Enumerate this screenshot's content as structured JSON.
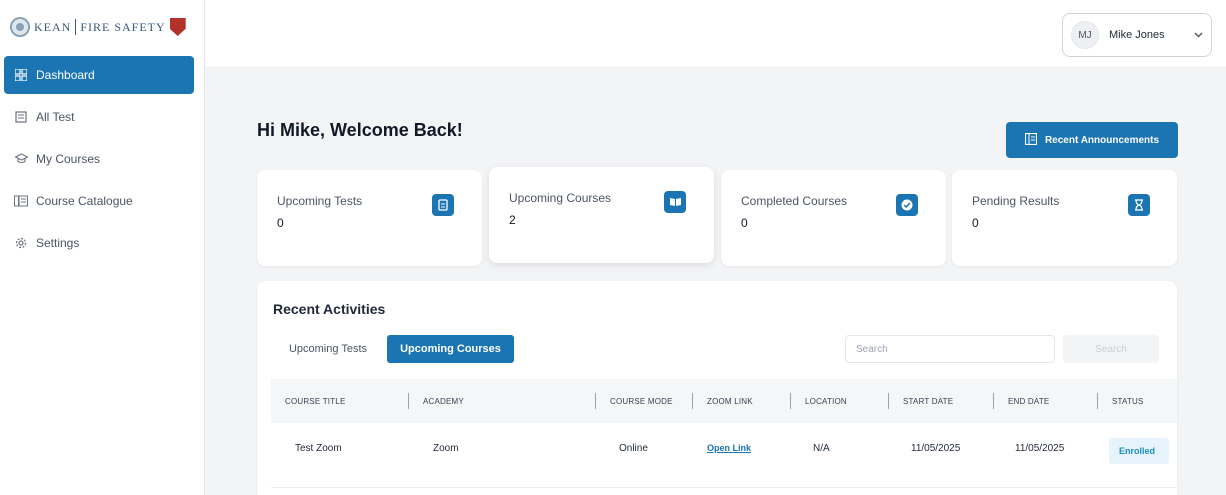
{
  "brand": {
    "left": "KEAN",
    "right": "FIRE SAFETY",
    "accent": "#1a75b2"
  },
  "sidebar": {
    "items": [
      {
        "label": "Dashboard",
        "icon": "grid-icon",
        "active": true
      },
      {
        "label": "All Test",
        "icon": "document-icon",
        "active": false
      },
      {
        "label": "My Courses",
        "icon": "graduation-cap-icon",
        "active": false
      },
      {
        "label": "Course Catalogue",
        "icon": "catalogue-icon",
        "active": false
      },
      {
        "label": "Settings",
        "icon": "gear-icon",
        "active": false
      }
    ]
  },
  "header": {
    "user": {
      "initials": "MJ",
      "name": "Mike Jones",
      "icon": "chevron-down-icon"
    }
  },
  "main": {
    "welcome": "Hi Mike, Welcome Back!",
    "announcements_label": "Recent Announcements",
    "stats": [
      {
        "label": "Upcoming Tests",
        "value": "0",
        "icon": "test-icon"
      },
      {
        "label": "Upcoming Courses",
        "value": "2",
        "icon": "book-icon"
      },
      {
        "label": "Completed Courses",
        "value": "0",
        "icon": "check-circle-icon"
      },
      {
        "label": "Pending Results",
        "value": "0",
        "icon": "hourglass-icon"
      }
    ]
  },
  "activity": {
    "title": "Recent Activities",
    "tabs": [
      {
        "label": "Upcoming Tests",
        "active": false
      },
      {
        "label": "Upcoming Courses",
        "active": true
      }
    ],
    "search": {
      "placeholder": "Search",
      "button_label": "Search"
    },
    "columns": [
      "COURSE TITLE",
      "ACADEMY",
      "COURSE MODE",
      "ZOOM LINK",
      "LOCATION",
      "START DATE",
      "END DATE",
      "STATUS"
    ],
    "rows": [
      {
        "course_title": "Test Zoom",
        "academy": "Zoom",
        "course_mode": "Online",
        "zoom_link": "Open Link",
        "location": "N/A",
        "start_date": "11/05/2025",
        "end_date": "11/05/2025",
        "status": "Enrolled"
      }
    ]
  }
}
